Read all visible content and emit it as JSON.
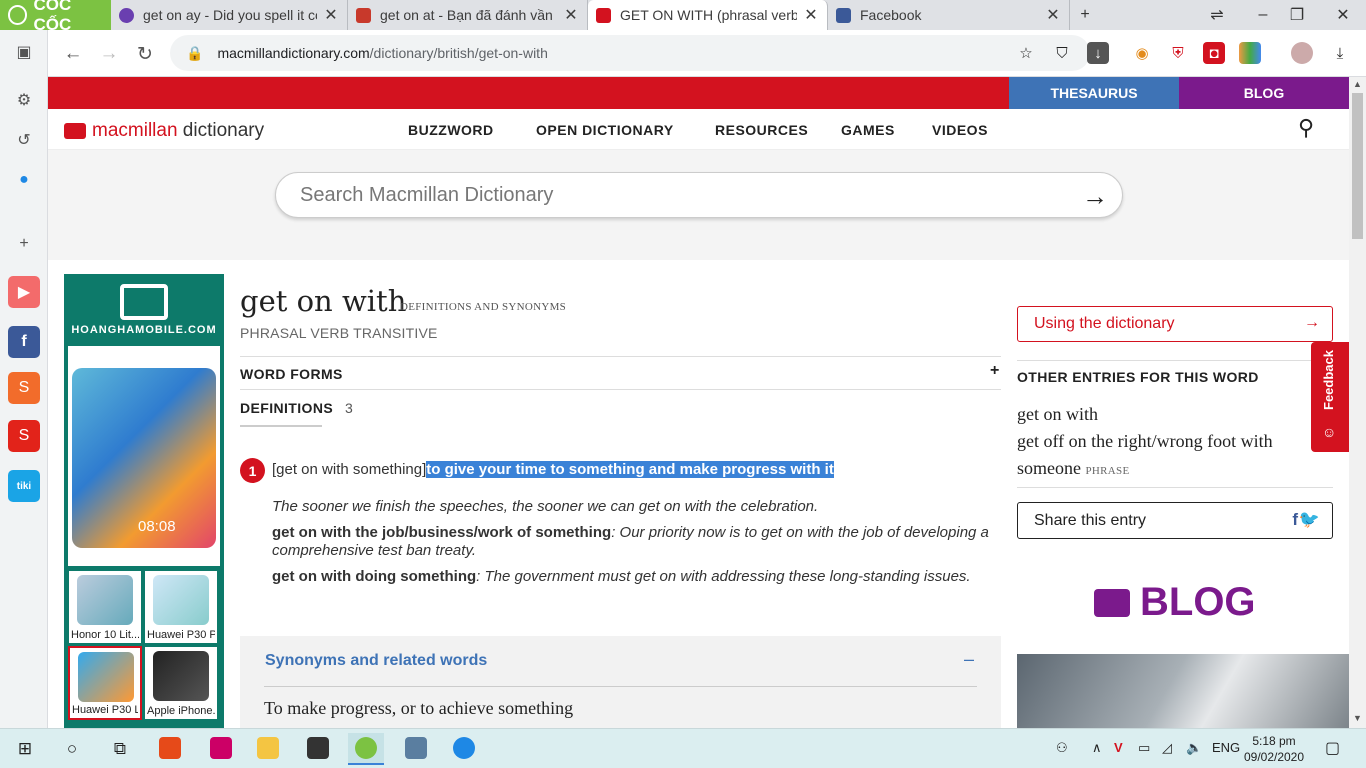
{
  "browser": {
    "logo": "CỐC CỐC",
    "tabs": [
      {
        "title": "get on ay - Did you spell it co"
      },
      {
        "title": "get on at - Bạn đã đánh vần c"
      },
      {
        "title": "GET ON WITH (phrasal verb) d"
      },
      {
        "title": "Facebook"
      }
    ],
    "url_host": "macmillandictionary.com",
    "url_path": "/dictionary/british/get-on-with"
  },
  "site": {
    "top_links": {
      "thesaurus": "THESAURUS",
      "blog": "BLOG"
    },
    "brand": {
      "part1": "macmillan",
      "part2": " dictionary"
    },
    "nav": [
      "BUZZWORD",
      "OPEN DICTIONARY",
      "RESOURCES",
      "GAMES",
      "VIDEOS"
    ],
    "search_placeholder": "Search Macmillan Dictionary"
  },
  "ad": {
    "brand": "HOANGHAMOBILE.COM",
    "hero_time": "08:08",
    "thumbs": [
      "Honor 10 Lit...",
      "Huawei P30 P...",
      "Huawei P30 L...",
      "Apple iPhone..."
    ]
  },
  "entry": {
    "headword": "get on with",
    "headword_sub": "DEFINITIONS AND SYNONYMS",
    "pos": "PHRASAL VERB  TRANSITIVE",
    "word_forms": "WORD FORMS",
    "word_forms_toggle": "+",
    "definitions_label": "DEFINITIONS",
    "definitions_count": "3",
    "sense_number": "1",
    "sense_grammar": "[get on with something]",
    "sense_def": "to give your time to something and make progress with it",
    "example1": "The sooner we finish the speeches, the sooner we can get on with the celebration.",
    "example2_phrase": "get on with the job/business/work of something",
    "example2_text": ": Our priority now is to get on with the job of developing a comprehensive test ban treaty.",
    "example3_phrase": "get on with doing something",
    "example3_text": ": The government must get on with addressing these long-standing issues.",
    "synonyms_title": "Synonyms and related words",
    "synonyms_toggle": "–",
    "synonyms_desc": "To make progress, or to achieve something"
  },
  "sidebar": {
    "using": "Using the dictionary",
    "others_title": "OTHER ENTRIES FOR THIS WORD",
    "others": [
      "get on with",
      "get off on the right/wrong foot with",
      "someone"
    ],
    "others_tag": "PHRASE",
    "share": "Share this entry",
    "feedback": "Feedback",
    "blog": "BLOG"
  },
  "taskbar": {
    "lang": "ENG",
    "time": "5:18 pm",
    "date": "09/02/2020"
  },
  "colors": {
    "brand_red": "#d3121f",
    "thesaurus_blue": "#3e73b6",
    "blog_purple": "#7b1a8c",
    "selection": "#3a82d7"
  }
}
